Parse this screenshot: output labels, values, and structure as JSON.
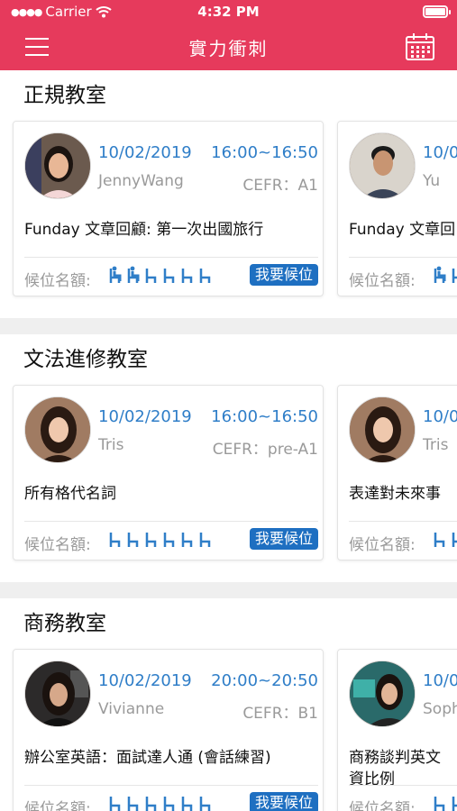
{
  "status_bar": {
    "carrier": "Carrier",
    "time": "4:32 PM"
  },
  "nav": {
    "title": "實力衝刺",
    "menu_icon": "hamburger-menu-icon",
    "calendar_icon": "calendar-icon"
  },
  "colors": {
    "header_bg": "#e63a5c",
    "accent_blue": "#2f7ec8",
    "button_blue": "#1e6fc1",
    "gray_text": "#9a9a9a"
  },
  "seat_label": "候位名額:",
  "waitlist_label": "我要候位",
  "sections": [
    {
      "title": "正規教室",
      "cards": [
        {
          "date": "10/02/2019",
          "time": "16:00~16:50",
          "teacher": "JennyWang",
          "cefr": "CEFR：A1",
          "topic": "Funday 文章回顧: 第一次出國旅行",
          "seats_taken": 2,
          "seats_total": 6
        },
        {
          "date": "10/0",
          "time": "",
          "teacher": "Yu",
          "cefr": "",
          "topic": "Funday 文章回",
          "seats_taken": 1,
          "seats_total": 2
        }
      ]
    },
    {
      "title": "文法進修教室",
      "cards": [
        {
          "date": "10/02/2019",
          "time": "16:00~16:50",
          "teacher": "Tris",
          "cefr": "CEFR：pre-A1",
          "topic": "所有格代名詞",
          "seats_taken": 0,
          "seats_total": 6
        },
        {
          "date": "10/0",
          "time": "",
          "teacher": "Tris",
          "cefr": "",
          "topic": "表達對未來事",
          "seats_taken": 0,
          "seats_total": 2
        }
      ]
    },
    {
      "title": "商務教室",
      "cards": [
        {
          "date": "10/02/2019",
          "time": "20:00~20:50",
          "teacher": "Vivianne",
          "cefr": "CEFR：B1",
          "topic": "辦公室英語：面試達人通 (會話練習)",
          "seats_taken": 0,
          "seats_total": 6
        },
        {
          "date": "10/0",
          "time": "",
          "teacher": "Soph",
          "cefr": "",
          "topic": "商務談判英文\n資比例",
          "seats_taken": 0,
          "seats_total": 2
        }
      ]
    }
  ]
}
